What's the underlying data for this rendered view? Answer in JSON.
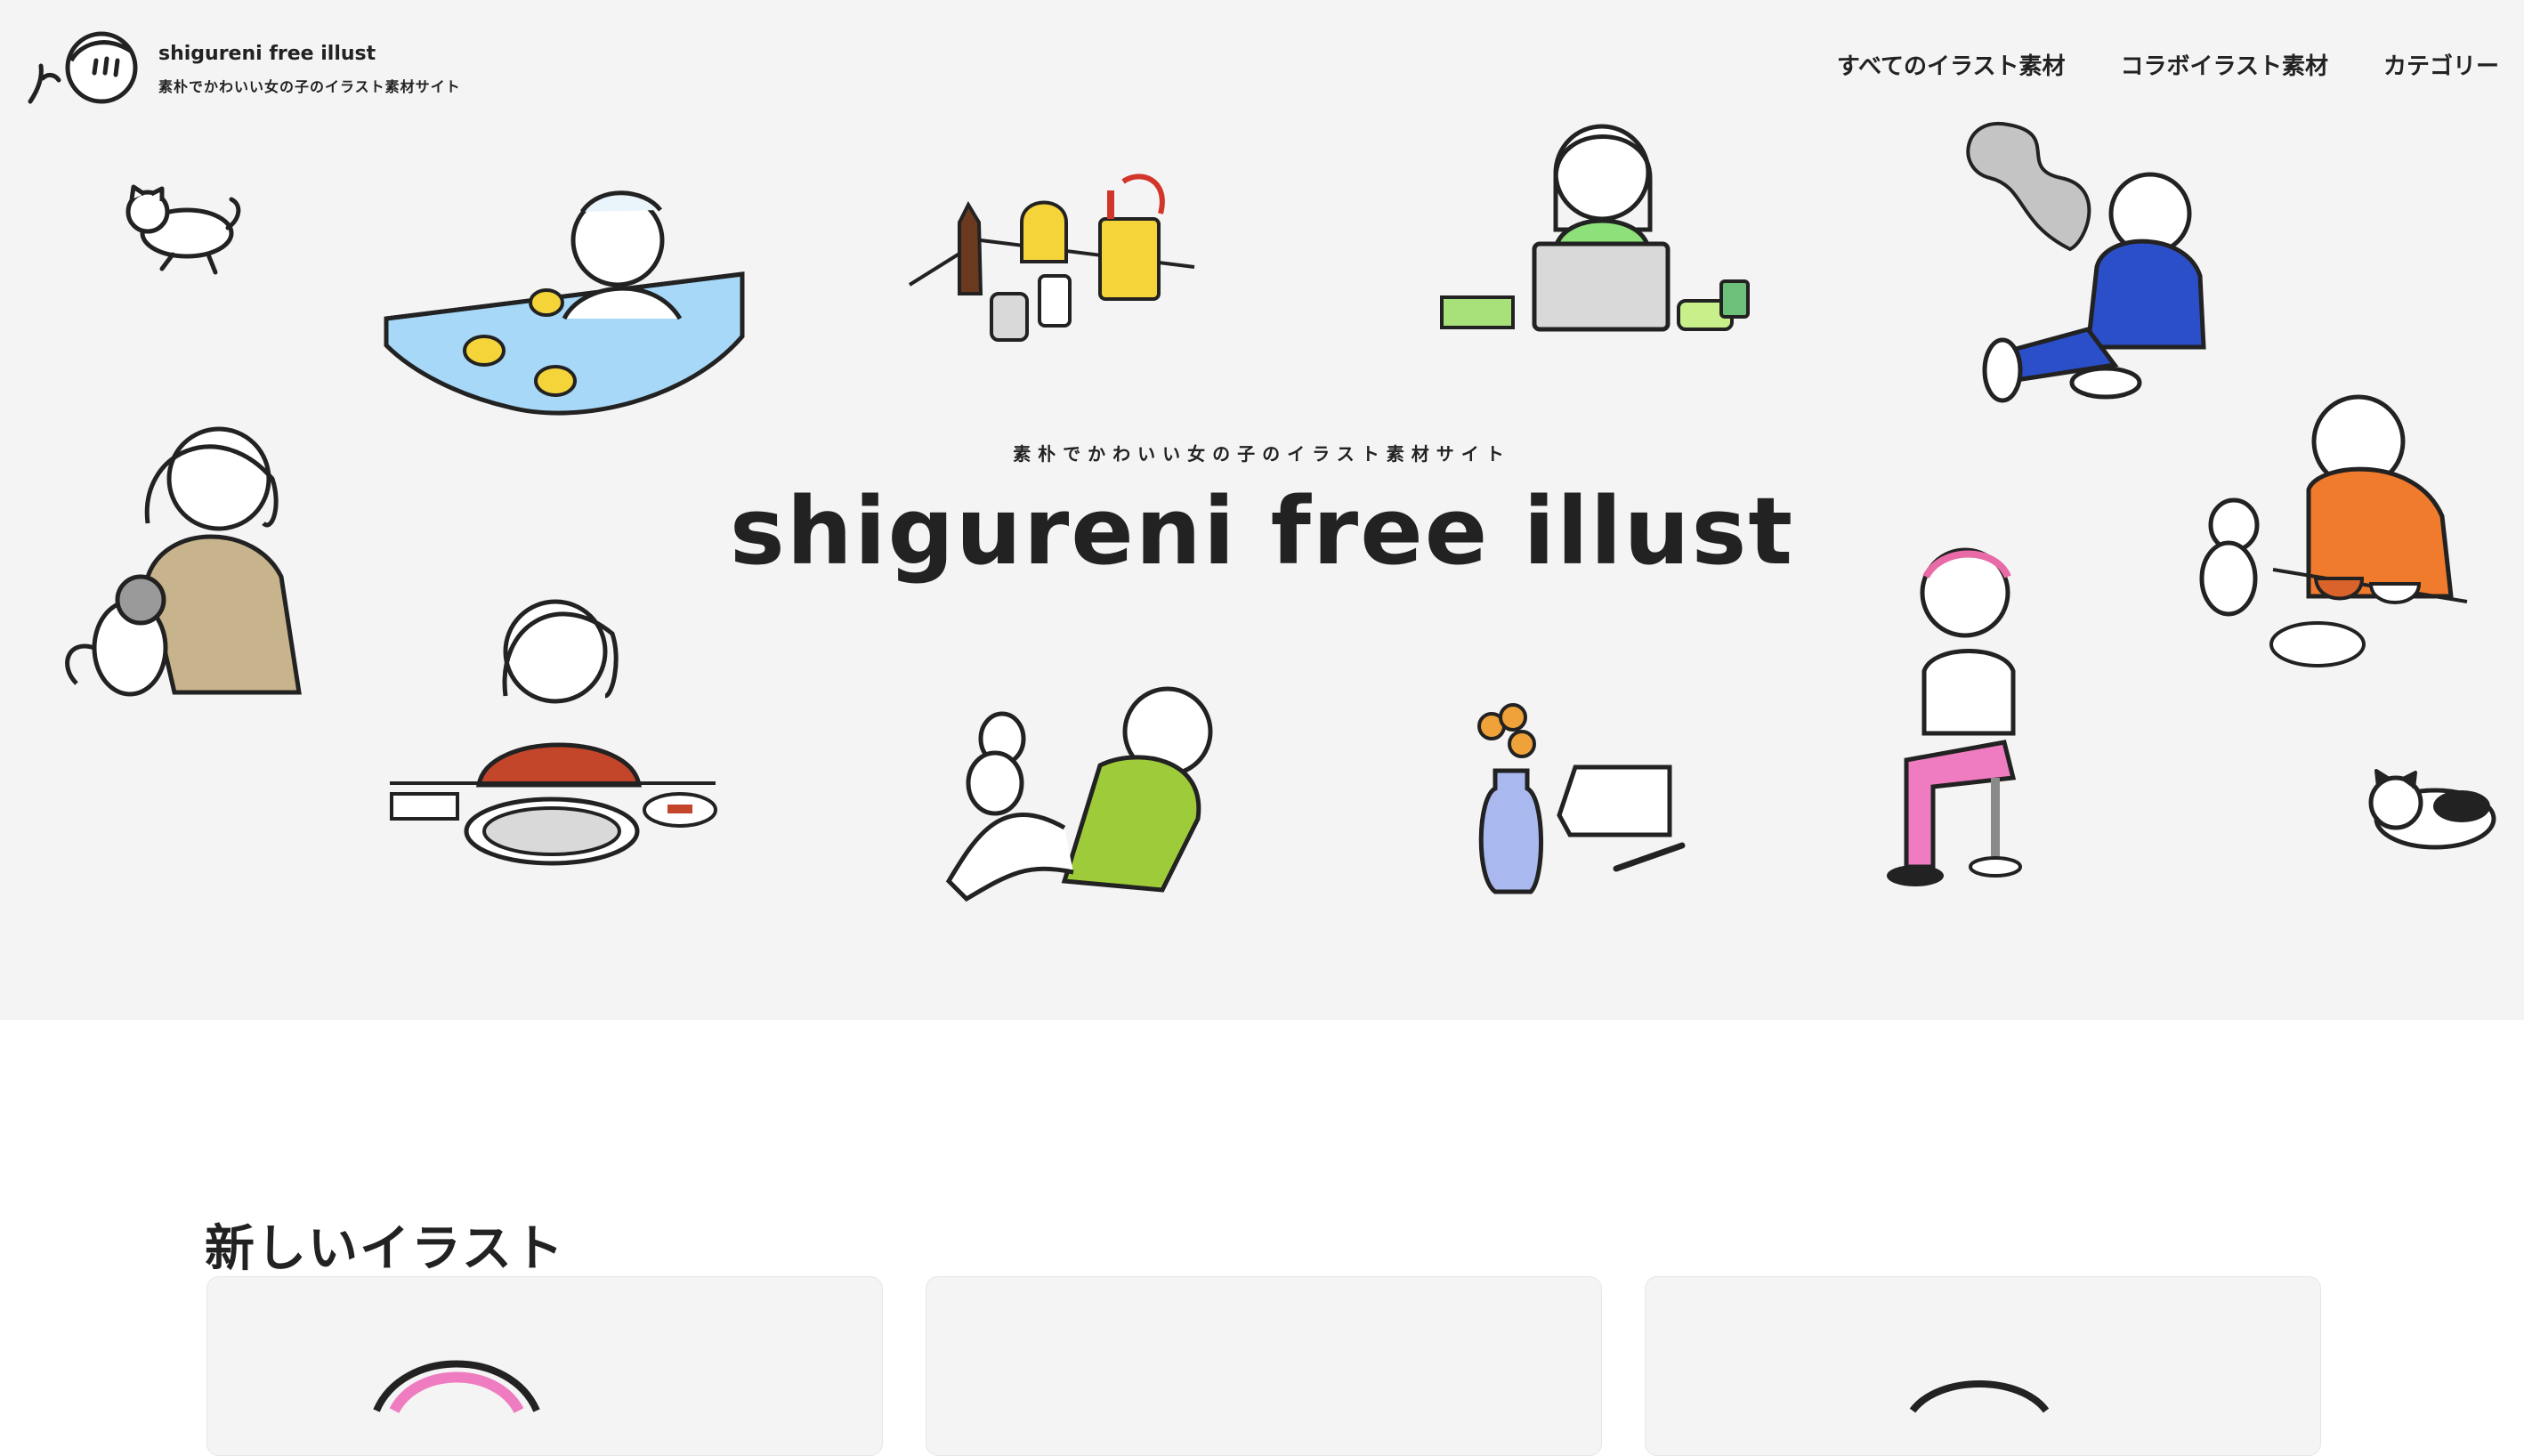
{
  "header": {
    "site_name": "shigureni free illust",
    "tagline": "素朴でかわいい女の子のイラスト素材サイト",
    "logo_icon": "girl-face-icon"
  },
  "nav": {
    "items": [
      {
        "label": "すべてのイラスト素材"
      },
      {
        "label": "コラボイラスト素材"
      },
      {
        "label": "カテゴリー"
      }
    ]
  },
  "hero": {
    "subtitle": "素朴でかわいい女の子のイラスト素材サイト",
    "title": "shigureni free illust"
  },
  "section": {
    "title": "新しいイラスト"
  },
  "colors": {
    "hero_bg": "#f4f4f4",
    "ink": "#222222",
    "accent_pink": "#ef7cc0",
    "accent_blue": "#2a4fc9",
    "accent_green": "#9fcf3a",
    "accent_orange": "#f07b2c"
  }
}
